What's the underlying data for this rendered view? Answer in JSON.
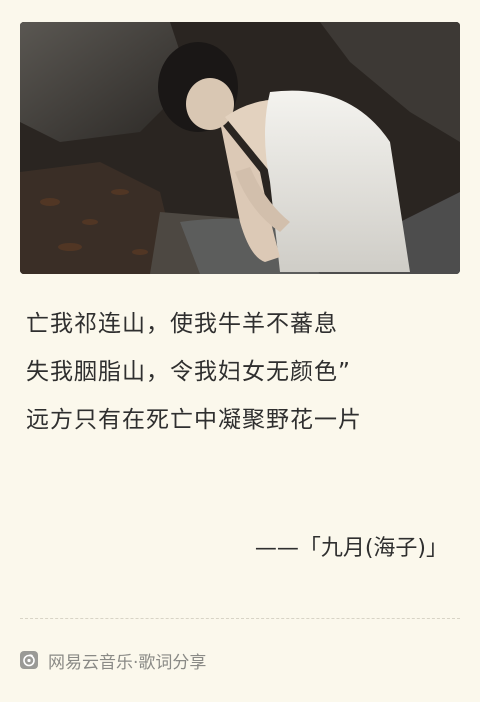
{
  "lyrics": {
    "lines": [
      "亡我祁连山，使我牛羊不蕃息",
      "失我胭脂山，令我妇女无颜色”",
      "远方只有在死亡中凝聚野花一片"
    ],
    "source": "——「九月(海子)」"
  },
  "footer": {
    "icon": "netease-cloud-music-icon",
    "text": "网易云音乐·歌词分享"
  },
  "colors": {
    "background": "#fbf8ec",
    "text": "#2f2f2f",
    "footer_text": "#8a8a86"
  }
}
